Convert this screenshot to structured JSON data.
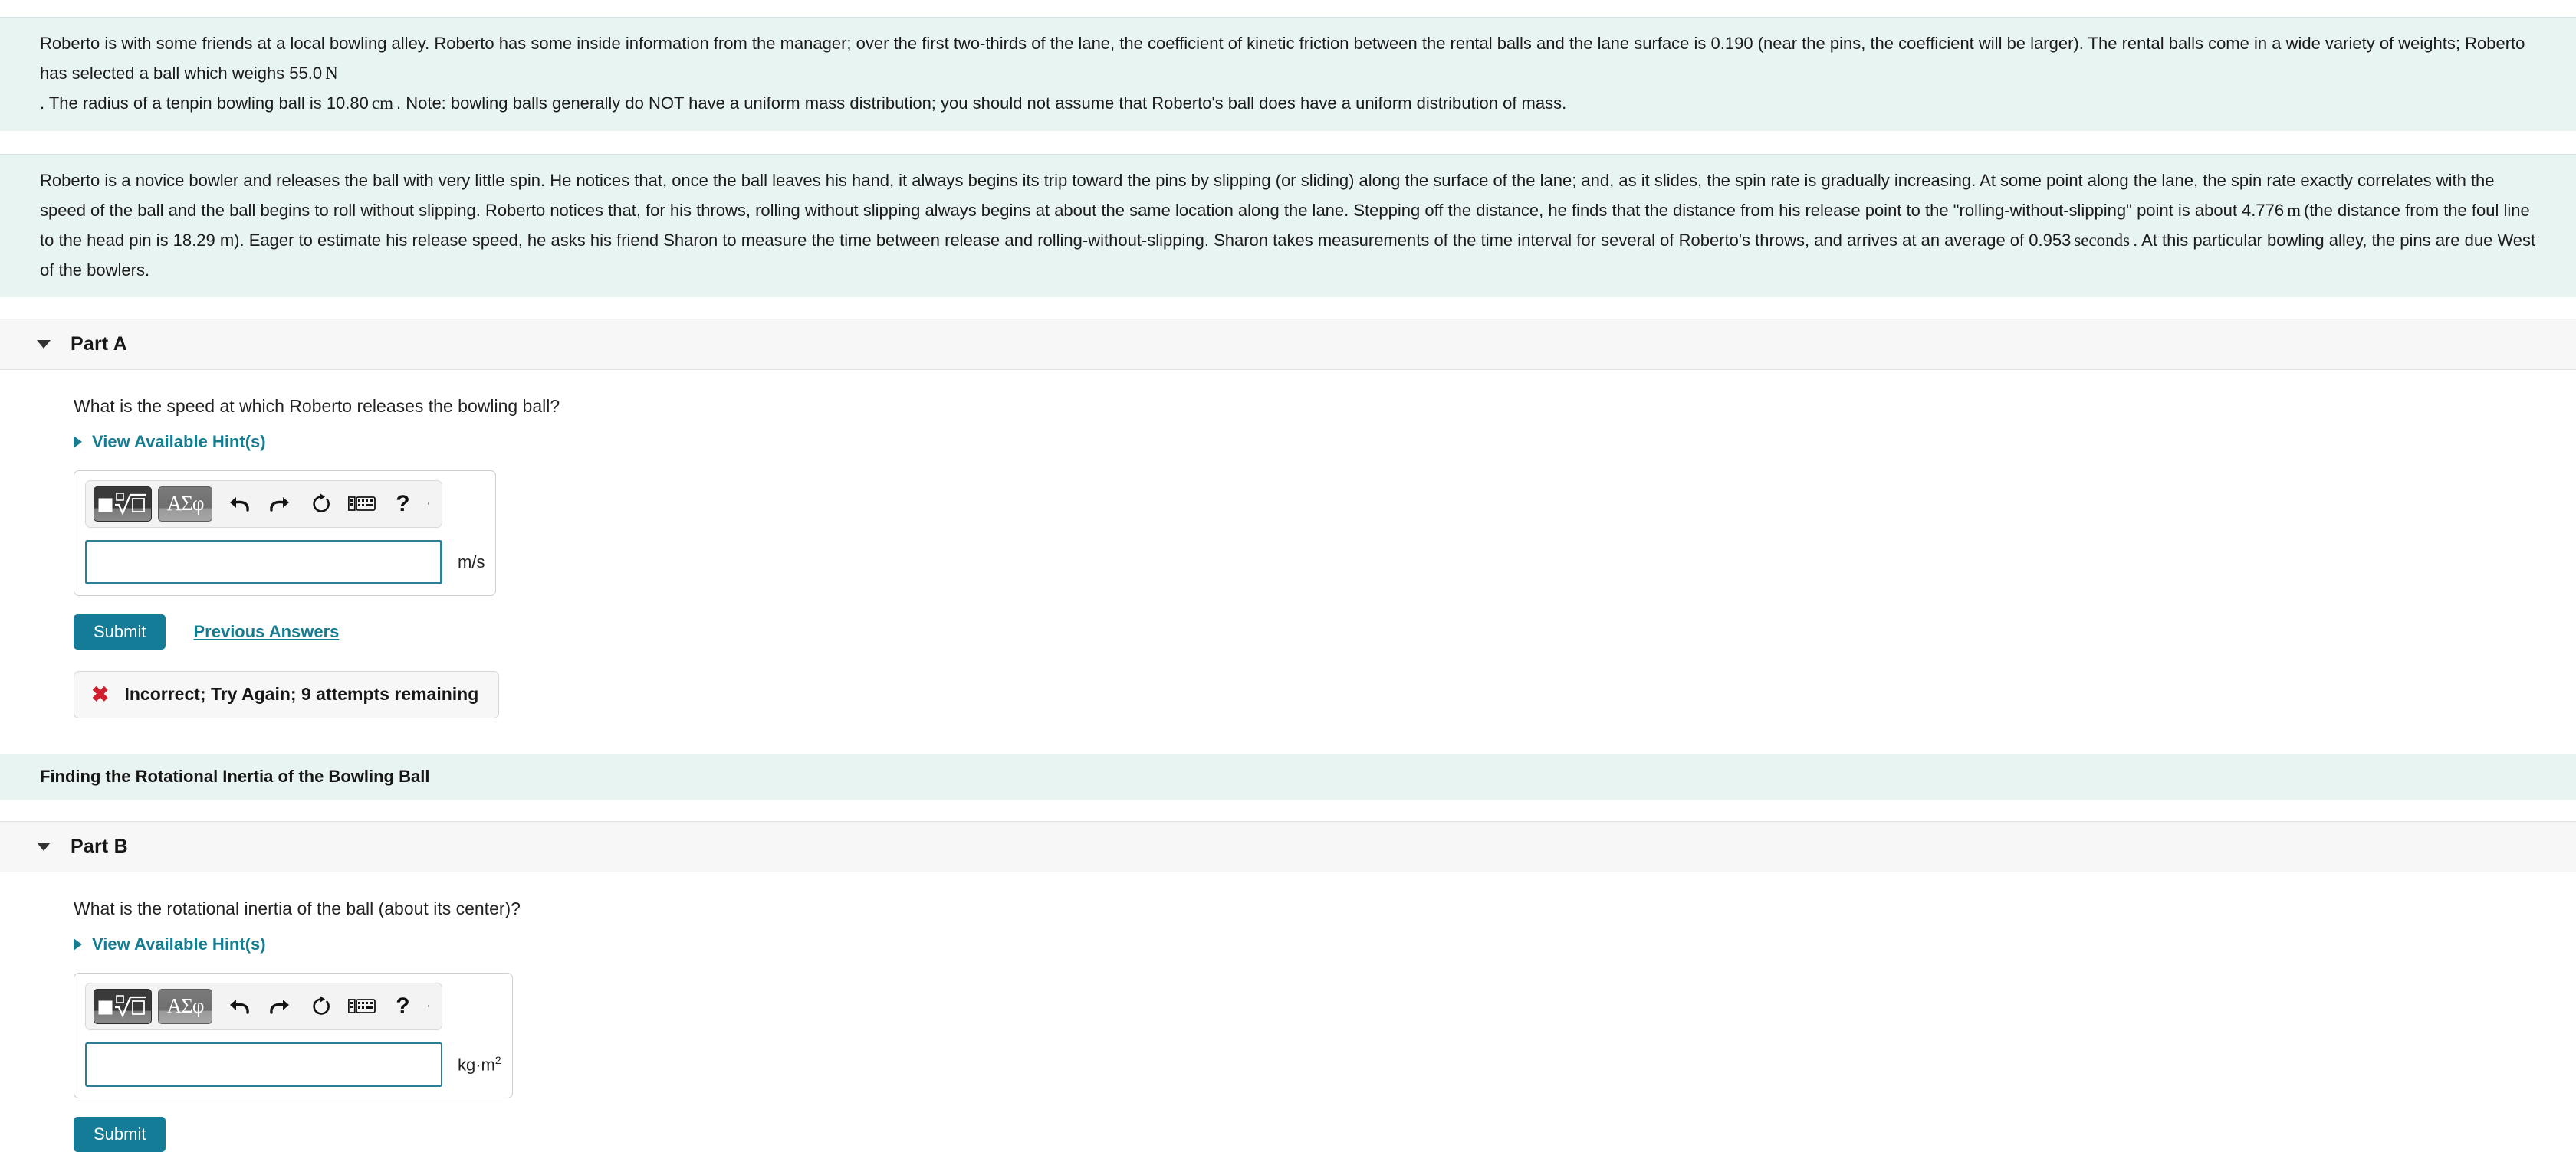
{
  "problem": {
    "paragraph1_part1": "Roberto is with some friends at a local bowling alley. Roberto has some inside information from the manager; over the first two-thirds of the lane, the coefficient of kinetic friction between the rental balls and the lane surface is 0.190 (near the pins, the coefficient will be larger). The rental balls come in a wide variety of weights; Roberto has selected a ball which weighs 55.0",
    "paragraph1_unit1": "N",
    "paragraph1_part2": ". The radius of a tenpin bowling ball is 10.80",
    "paragraph1_unit2": "cm",
    "paragraph1_part3": ". Note: bowling balls generally do NOT have a uniform mass distribution; you should not assume that Roberto's ball does have a uniform distribution of mass.",
    "paragraph2_part1": "Roberto is a novice bowler and releases the ball with very little spin. He notices that, once the ball leaves his hand, it always begins its trip toward the pins by slipping (or sliding) along the surface of the lane; and, as it slides, the spin rate is gradually increasing. At some point along the lane, the spin rate exactly correlates with the speed of the ball and the ball begins to roll without slipping. Roberto notices that, for his throws, rolling without slipping always begins at about the same location along the lane. Stepping off the distance, he finds that the distance from his release point to the \"rolling-without-slipping\" point is about 4.776",
    "paragraph2_unit1": "m",
    "paragraph2_part2": "(the distance from the foul line to the head pin is 18.29 m). Eager to estimate his release speed, he asks his friend Sharon to measure the time between release and rolling-without-slipping. Sharon takes measurements of the time interval for several of Roberto's throws, and arrives at an average of 0.953",
    "paragraph2_unit2": "seconds",
    "paragraph2_part3": ". At this particular bowling alley, the pins are due West of the bowlers."
  },
  "section_banner": {
    "label": "Finding the Rotational Inertia of the Bowling Ball"
  },
  "toolbar": {
    "template_icon": "template-sqrt-icon",
    "greek_label": "ΑΣφ",
    "undo_icon": "undo-arrow-icon",
    "redo_icon": "redo-arrow-icon",
    "reset_icon": "reset-circular-arrow-icon",
    "keyboard_icon": "keyboard-icon",
    "help_label": "?",
    "more_label": "·"
  },
  "partA": {
    "title": "Part A",
    "question": "What is the speed at which Roberto releases the bowling ball?",
    "hints_label": "View Available Hint(s)",
    "input_value": "",
    "input_placeholder": "",
    "unit": "m/s",
    "submit_label": "Submit",
    "previous_answers_label": "Previous Answers",
    "feedback": {
      "icon": "x-mark-icon",
      "text": "Incorrect; Try Again; 9 attempts remaining",
      "color": "#d0202f"
    }
  },
  "partB": {
    "title": "Part B",
    "question": "What is the rotational inertia of the ball (about its center)?",
    "hints_label": "View Available Hint(s)",
    "input_value": "",
    "input_placeholder": "",
    "unit_base": "kg·m",
    "unit_exponent": "2",
    "submit_label": "Submit"
  },
  "colors": {
    "accent": "#157c98",
    "link": "#157c91",
    "banner_bg": "#e8f4f2",
    "error": "#d0202f"
  }
}
